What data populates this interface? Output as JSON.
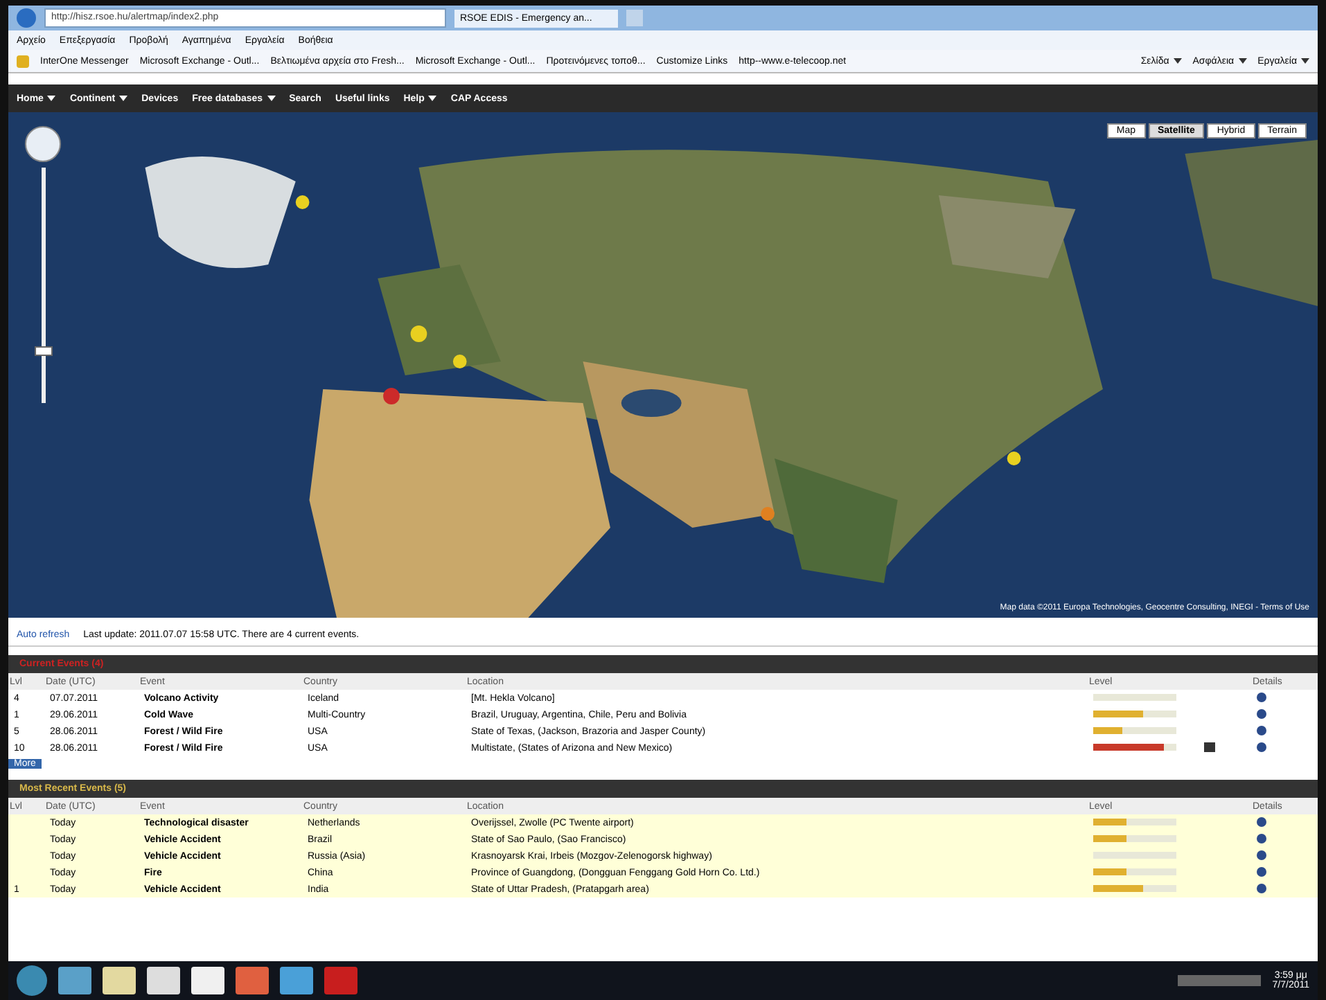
{
  "browser": {
    "address": "http://hisz.rsoe.hu/alertmap/index2.php",
    "tab_title": "RSOE EDIS - Emergency an...",
    "menu": [
      "Αρχείο",
      "Επεξεργασία",
      "Προβολή",
      "Αγαπημένα",
      "Εργαλεία",
      "Βοήθεια"
    ],
    "favorites": [
      "InterOne Messenger",
      "Microsoft Exchange - Outl...",
      "Βελτιωμένα αρχεία στο Fresh...",
      "Microsoft Exchange - Outl...",
      "Προτεινόμενες τοποθ...",
      "Customize Links",
      "http--www.e-telecoop.net"
    ],
    "commands": [
      "Σελίδα",
      "Ασφάλεια",
      "Εργαλεία"
    ]
  },
  "nav": [
    {
      "label": "Home",
      "dropdown": true
    },
    {
      "label": "Continent",
      "dropdown": true
    },
    {
      "label": "Devices",
      "dropdown": false
    },
    {
      "label": "Free databases",
      "dropdown": true
    },
    {
      "label": "Search",
      "dropdown": false
    },
    {
      "label": "Useful links",
      "dropdown": false
    },
    {
      "label": "Help",
      "dropdown": true
    },
    {
      "label": "CAP Access",
      "dropdown": false
    }
  ],
  "map": {
    "zoom": {
      "level": 0.2
    },
    "map_types": [
      {
        "label": "Map",
        "selected": false
      },
      {
        "label": "Satellite",
        "selected": true
      },
      {
        "label": "Hybrid",
        "selected": false
      },
      {
        "label": "Terrain",
        "selected": false
      }
    ],
    "attribution": "Map data ©2011 Europa Technologies, Geocentre Consulting, INEGI - Terms of Use"
  },
  "info_bar": {
    "refresh": "Auto refresh",
    "note": "Last update: 2011.07.07 15:58 UTC. There are 4 current events."
  },
  "sections": [
    {
      "title": "Current Events (4)",
      "color": "#cc2222",
      "highlight": false,
      "columns": [
        "Lvl",
        "Date (UTC)",
        "Event",
        "Country",
        "Location",
        "Level",
        "Details"
      ],
      "rows": [
        {
          "lvl": "4",
          "date": "07.07.2011",
          "event": "Volcano Activity",
          "country": "Iceland",
          "location": "[Mt. Hekla Volcano]",
          "level": 0.0,
          "camera": false
        },
        {
          "lvl": "1",
          "date": "29.06.2011",
          "event": "Cold Wave",
          "country": "Multi-Country",
          "location": "Brazil, Uruguay, Argentina, Chile, Peru and Bolivia",
          "level": 0.6,
          "camera": false
        },
        {
          "lvl": "5",
          "date": "28.06.2011",
          "event": "Forest / Wild Fire",
          "country": "USA",
          "location": "State of Texas, (Jackson, Brazoria and Jasper County)",
          "level": 0.35,
          "camera": false
        },
        {
          "lvl": "10",
          "date": "28.06.2011",
          "event": "Forest / Wild Fire",
          "country": "USA",
          "location": "Multistate, (States of Arizona and New Mexico)",
          "level": 0.85,
          "camera": true
        }
      ],
      "pager": "More"
    },
    {
      "title": "Most Recent Events (5)",
      "color": "#d8b84a",
      "highlight": true,
      "columns": [
        "Lvl",
        "Date (UTC)",
        "Event",
        "Country",
        "Location",
        "Level",
        "Details"
      ],
      "rows": [
        {
          "lvl": "",
          "date": "Today",
          "event": "Technological disaster",
          "country": "Netherlands",
          "location": "Overijssel, Zwolle (PC Twente airport)",
          "level": 0.4,
          "camera": false
        },
        {
          "lvl": "",
          "date": "Today",
          "event": "Vehicle Accident",
          "country": "Brazil",
          "location": "State of Sao Paulo, (Sao Francisco)",
          "level": 0.4,
          "camera": false
        },
        {
          "lvl": "",
          "date": "Today",
          "event": "Vehicle Accident",
          "country": "Russia (Asia)",
          "location": "Krasnoyarsk Krai, Irbeis (Mozgov-Zelenogorsk highway)",
          "level": 0.0,
          "camera": false
        },
        {
          "lvl": "",
          "date": "Today",
          "event": "Fire",
          "country": "China",
          "location": "Province of Guangdong, (Dongguan Fenggang Gold Horn Co. Ltd.)",
          "level": 0.4,
          "camera": false
        },
        {
          "lvl": "1",
          "date": "Today",
          "event": "Vehicle Accident",
          "country": "India",
          "location": "State of Uttar Pradesh, (Pratapgarh area)",
          "level": 0.6,
          "camera": false
        }
      ]
    }
  ],
  "taskbar": {
    "apps": [
      {
        "kind": "explorer"
      },
      {
        "kind": "folder"
      },
      {
        "kind": "player"
      },
      {
        "kind": "word"
      },
      {
        "kind": "powerpoint"
      },
      {
        "kind": "ie"
      },
      {
        "kind": "pdf"
      }
    ],
    "time": "3:59 μμ",
    "date": "7/7/2011"
  }
}
